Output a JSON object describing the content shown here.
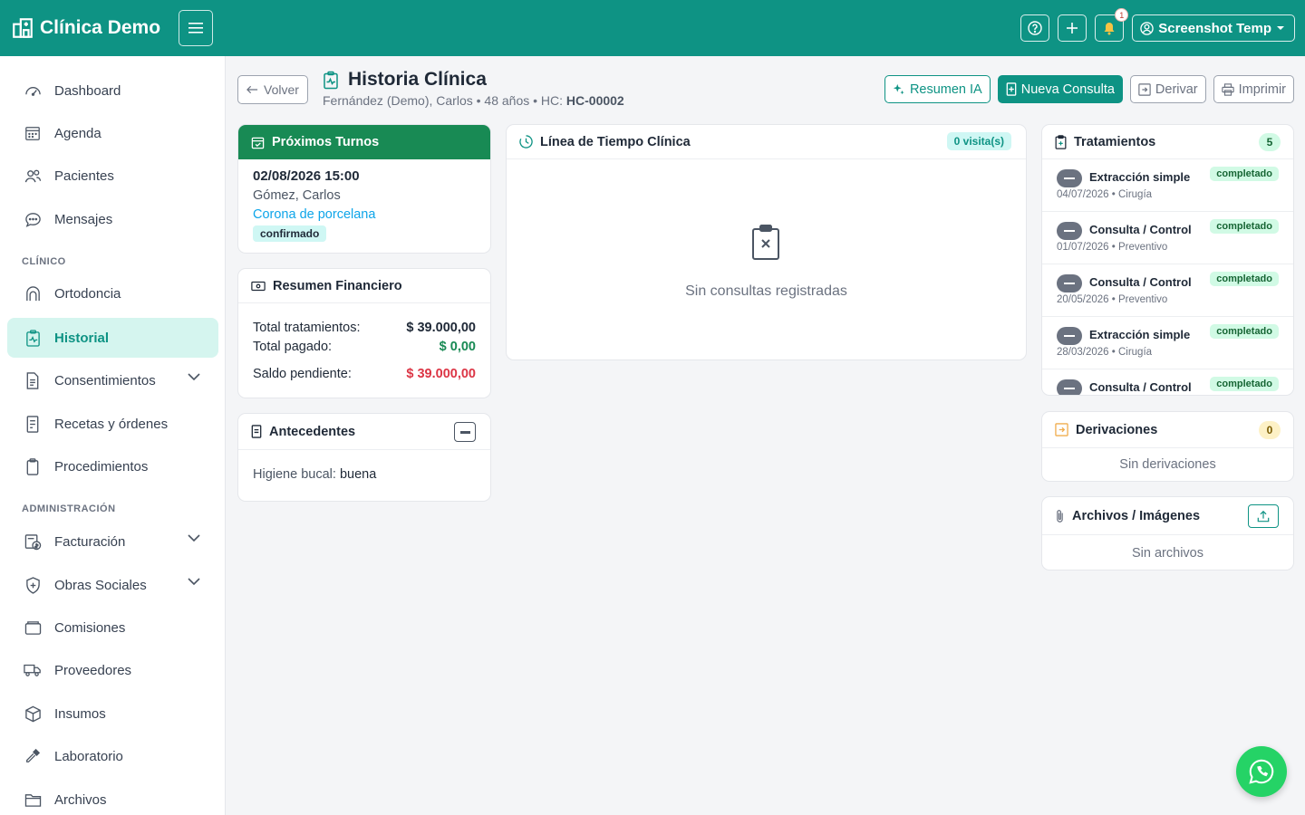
{
  "brand": {
    "name": "Clínica Demo"
  },
  "topbar": {
    "notification_count": "1",
    "user_name": "Screenshot Temp"
  },
  "sidebar": {
    "items": [
      {
        "label": "Dashboard"
      },
      {
        "label": "Agenda"
      },
      {
        "label": "Pacientes"
      },
      {
        "label": "Mensajes"
      },
      {
        "label": "Ortodoncia"
      },
      {
        "label": "Historial"
      },
      {
        "label": "Consentimientos"
      },
      {
        "label": "Recetas y órdenes"
      },
      {
        "label": "Procedimientos"
      },
      {
        "label": "Facturación"
      },
      {
        "label": "Obras Sociales"
      },
      {
        "label": "Comisiones"
      },
      {
        "label": "Proveedores"
      },
      {
        "label": "Insumos"
      },
      {
        "label": "Laboratorio"
      },
      {
        "label": "Archivos"
      }
    ],
    "sections": {
      "clinico": "CLÍNICO",
      "administracion": "ADMINISTRACIÓN"
    }
  },
  "header": {
    "back_label": "Volver",
    "title": "Historia Clínica",
    "patient_info": "Fernández (Demo), Carlos • 48 años • HC: ",
    "hc_code": "HC-00002"
  },
  "actions": {
    "resumen_ia": "Resumen IA",
    "nueva_consulta": "Nueva Consulta",
    "derivar": "Derivar",
    "imprimir": "Imprimir"
  },
  "turnos": {
    "title": "Próximos Turnos",
    "date": "02/08/2026 15:00",
    "patient": "Gómez, Carlos",
    "procedure": "Corona de porcelana",
    "status": "confirmado"
  },
  "finanzas": {
    "title": "Resumen Financiero",
    "total_label": "Total tratamientos:",
    "total_value": "$ 39.000,00",
    "paid_label": "Total pagado:",
    "paid_value": "$ 0,00",
    "balance_label": "Saldo pendiente:",
    "balance_value": "$ 39.000,00"
  },
  "antecedentes": {
    "title": "Antecedentes",
    "higiene_label": "Higiene bucal:",
    "higiene_value": "buena"
  },
  "timeline": {
    "title": "Línea de Tiempo Clínica",
    "visits": "0 visita(s)",
    "empty": "Sin consultas registradas"
  },
  "tratamientos": {
    "title": "Tratamientos",
    "count": "5",
    "items": [
      {
        "name": "Extracción simple",
        "date": "04/07/2026 • Cirugía",
        "status": "completado"
      },
      {
        "name": "Consulta / Control",
        "date": "01/07/2026 • Preventivo",
        "status": "completado"
      },
      {
        "name": "Consulta / Control",
        "date": "20/05/2026 • Preventivo",
        "status": "completado"
      },
      {
        "name": "Extracción simple",
        "date": "28/03/2026 • Cirugía",
        "status": "completado"
      },
      {
        "name": "Consulta / Control",
        "date": "",
        "status": "completado"
      }
    ]
  },
  "derivaciones": {
    "title": "Derivaciones",
    "count": "0",
    "empty": "Sin derivaciones"
  },
  "archivos": {
    "title": "Archivos / Imágenes",
    "empty": "Sin archivos"
  },
  "colors": {
    "primary": "#0e9384",
    "success": "#188a54",
    "danger": "#dc3545",
    "link": "#0ea5e9"
  }
}
